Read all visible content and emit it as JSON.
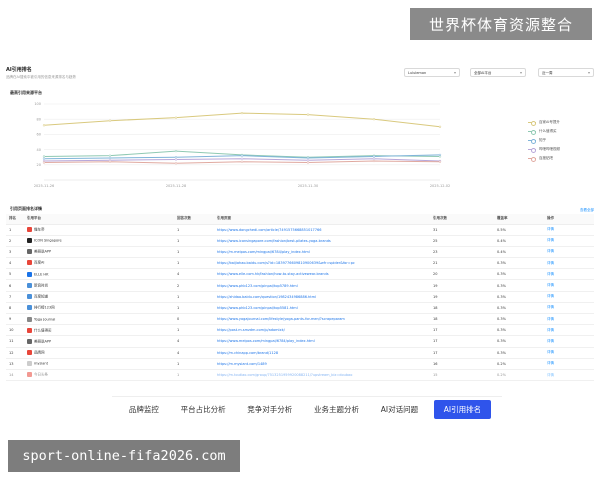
{
  "watermark_top": "世界杯体育资源整合",
  "watermark_bottom": "sport-online-fifa2026.com",
  "panel": {
    "title": "AI引用排名",
    "subtitle": "品牌在AI搜索中被引用的信息来源排名与趋势",
    "selects": [
      {
        "value": "Lululemon"
      },
      {
        "value": "全部AI平台"
      },
      {
        "value": "近一周"
      }
    ]
  },
  "chart_section_title": "最高引用来源平台",
  "chart_data": {
    "type": "line",
    "x": [
      "2025-11-26",
      "2025-11-27",
      "2025-11-28",
      "2025-11-29",
      "2025-11-30",
      "2025-12-01",
      "2025-12-02"
    ],
    "x_tick_labels": [
      "2025-11-26",
      "2025-11-28",
      "2025-11-30",
      "2025-12-02"
    ],
    "ylim": [
      0,
      100
    ],
    "y_ticks": [
      "100",
      "80",
      "60",
      "40",
      "20"
    ],
    "series": [
      {
        "name": "百家AI号提升",
        "color": "#d9c97e",
        "values": [
          72,
          78,
          82,
          88,
          86,
          80,
          70
        ]
      },
      {
        "name": "什么值得买",
        "color": "#8fc9b3",
        "values": [
          31,
          32,
          38,
          33,
          30,
          32,
          31
        ]
      },
      {
        "name": "知乎",
        "color": "#7fb4d9",
        "values": [
          28,
          29,
          30,
          32,
          29,
          31,
          33
        ]
      },
      {
        "name": "哔哩哔哩视频",
        "color": "#b7a6d9",
        "values": [
          25,
          26,
          27,
          28,
          26,
          28,
          25
        ]
      },
      {
        "name": "百度贴吧",
        "color": "#e0a9a0",
        "values": [
          23,
          24,
          22,
          24,
          23,
          25,
          24
        ]
      }
    ],
    "grid": true,
    "legend_position": "right"
  },
  "table_section_title": "引用页面排名详情",
  "table_link_label": "查看全部",
  "table": {
    "columns": [
      "排名",
      "引用平台",
      "回答次数",
      "引用页面",
      "引用次数",
      "覆盖率",
      "操作"
    ],
    "rows": [
      {
        "rank": "1",
        "platform": "懂车帝",
        "answers": "1",
        "url": "https://www.dongchedi.com/article/7491575668851017766",
        "cites": "31",
        "coverage": "0.5%",
        "op": "详情",
        "logo": "#e8463a"
      },
      {
        "rank": "2",
        "platform": "ICON Singapore",
        "answers": "1",
        "url": "https://www.iconsingapore.com/fashion/best-pilates-yoga-brands",
        "cites": "25",
        "coverage": "0.4%",
        "op": "详情",
        "logo": "#222222"
      },
      {
        "rank": "3",
        "platform": "美丽说APP",
        "answers": "1",
        "url": "https://m.meipos.com/mingpai/6784/play_index.html",
        "cites": "23",
        "coverage": "0.4%",
        "op": "详情",
        "logo": "#666666"
      },
      {
        "rank": "4",
        "platform": "百度AI",
        "answers": "1",
        "url": "https://baijiahao.baidu.com/s?id=1839776609810900639&wfr=spider&for=pc",
        "cites": "21",
        "coverage": "0.3%",
        "op": "详情",
        "logo": "#e8463a"
      },
      {
        "rank": "5",
        "platform": "ELLE HK",
        "answers": "4",
        "url": "https://www.elle.com.hk/fashion/how-to-stay-activewear-brands",
        "cites": "20",
        "coverage": "0.3%",
        "op": "详情",
        "logo": "#1a73e8"
      },
      {
        "rank": "6",
        "platform": "新浪时尚",
        "answers": "2",
        "url": "https://www.phb123.com/pinpai/top5789.html",
        "cites": "19",
        "coverage": "0.3%",
        "op": "详情",
        "logo": "#4a90d9"
      },
      {
        "rank": "7",
        "platform": "百度知道",
        "answers": "1",
        "url": "https://zhidao.baidu.com/question/1982434986886.html",
        "cites": "19",
        "coverage": "0.3%",
        "op": "详情",
        "logo": "#4a90d9"
      },
      {
        "rank": "8",
        "platform": "排行榜123网",
        "answers": "1",
        "url": "https://www.phb123.com/pinpai/top5581.html",
        "cites": "18",
        "coverage": "0.3%",
        "op": "详情",
        "logo": "#4a90d9"
      },
      {
        "rank": "9",
        "platform": "Yoga Journal",
        "answers": "0",
        "url": "https://www.yogajournal.com/lifestyle/yoga-pants-for-men/?scrapeparam",
        "cites": "18",
        "coverage": "0.3%",
        "op": "详情",
        "logo": "#888888"
      },
      {
        "rank": "10",
        "platform": "什么值得买",
        "answers": "1",
        "url": "https://post.m.smzdm.com/p/adomlxk/",
        "cites": "17",
        "coverage": "0.3%",
        "op": "详情",
        "logo": "#e8463a"
      },
      {
        "rank": "11",
        "platform": "美丽说APP",
        "answers": "4",
        "url": "https://www.meipos.com/mingpai/6784/play_index.html",
        "cites": "17",
        "coverage": "0.3%",
        "op": "详情",
        "logo": "#666666"
      },
      {
        "rank": "12",
        "platform": "品牌网",
        "answers": "4",
        "url": "https://m.chinapp.com/brand/1128",
        "cites": "17",
        "coverage": "0.3%",
        "op": "详情",
        "logo": "#e8463a"
      },
      {
        "rank": "13",
        "platform": "mysiant",
        "answers": "1",
        "url": "https://m.mysiant.com/1489",
        "cites": "16",
        "coverage": "0.2%",
        "op": "详情",
        "logo": "#cccccc"
      },
      {
        "rank": "14",
        "platform": "今日头条",
        "answers": "1",
        "url": "https://m.toutiao.com/group/7513251959920088211/?upstream_biz=doubao",
        "cites": "15",
        "coverage": "0.2%",
        "op": "详情",
        "logo": "#e8463a"
      }
    ]
  },
  "tabs": [
    {
      "label": "品牌监控"
    },
    {
      "label": "平台占比分析"
    },
    {
      "label": "竞争对手分析"
    },
    {
      "label": "业务主题分析"
    },
    {
      "label": "AI对话问题"
    },
    {
      "label": "AI引用排名"
    }
  ]
}
